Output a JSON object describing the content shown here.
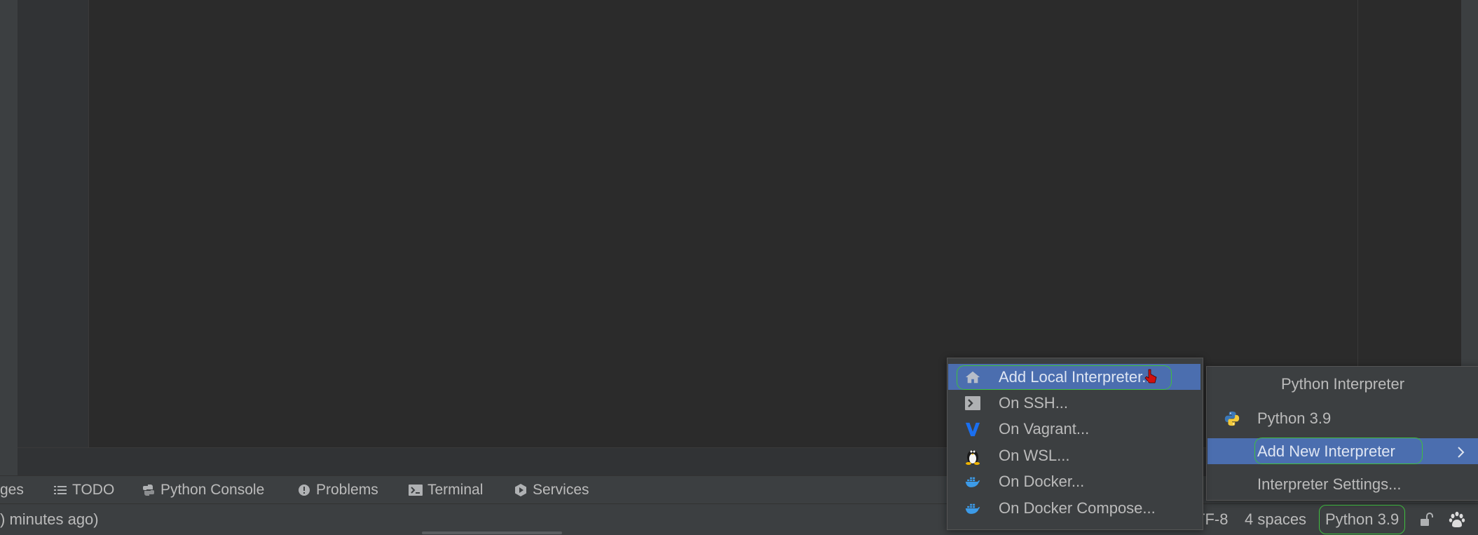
{
  "tool_windows": [
    {
      "label": "ges",
      "icon": "none"
    },
    {
      "label": "TODO",
      "icon": "list-icon"
    },
    {
      "label": "Python Console",
      "icon": "python-console-icon"
    },
    {
      "label": "Problems",
      "icon": "problems-icon"
    },
    {
      "label": "Terminal",
      "icon": "terminal-icon"
    },
    {
      "label": "Services",
      "icon": "services-icon"
    }
  ],
  "status_bar": {
    "vcs_time": ") minutes ago)",
    "encoding": "TF-8",
    "indent": "4 spaces",
    "interpreter": "Python 3.9",
    "lock_icon": "unlock-icon",
    "extra_icon": "paw-icon"
  },
  "interpreter_popup": {
    "title": "Python Interpreter",
    "items": [
      {
        "label": "Python 3.9",
        "icon": "python-icon"
      },
      {
        "label": "Add New Interpreter",
        "icon": "chevron-right-icon",
        "selected": true
      },
      {
        "label": "Interpreter Settings..."
      }
    ]
  },
  "add_interpreter_submenu": {
    "items": [
      {
        "label": "Add Local Interpreter...",
        "icon": "home-icon",
        "selected": true
      },
      {
        "label": "On SSH...",
        "icon": "terminal-icon"
      },
      {
        "label": "On Vagrant...",
        "icon": "vagrant-icon"
      },
      {
        "label": "On WSL...",
        "icon": "linux-tux-icon"
      },
      {
        "label": "On Docker...",
        "icon": "docker-icon"
      },
      {
        "label": "On Docker Compose...",
        "icon": "docker-icon"
      }
    ]
  },
  "colors": {
    "selection": "#4b6eaf",
    "highlight_outline": "#3fbf3f",
    "panel": "#3c3f41",
    "editor": "#2b2b2b"
  }
}
